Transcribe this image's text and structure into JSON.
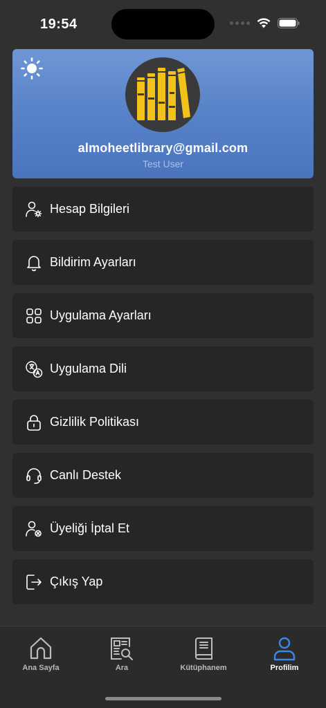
{
  "status": {
    "time": "19:54"
  },
  "profile": {
    "email": "almoheetlibrary@gmail.com",
    "name": "Test User"
  },
  "menu": [
    {
      "label": "Hesap Bilgileri",
      "icon": "user-gear-icon"
    },
    {
      "label": "Bildirim Ayarları",
      "icon": "bell-icon"
    },
    {
      "label": "Uygulama Ayarları",
      "icon": "apps-grid-icon"
    },
    {
      "label": "Uygulama Dili",
      "icon": "language-icon"
    },
    {
      "label": "Gizlilik Politikası",
      "icon": "lock-icon"
    },
    {
      "label": "Canlı Destek",
      "icon": "headset-icon"
    },
    {
      "label": "Üyeliği İptal Et",
      "icon": "user-remove-icon"
    },
    {
      "label": "Çıkış Yap",
      "icon": "logout-icon"
    }
  ],
  "nav": [
    {
      "label": "Ana Sayfa",
      "icon": "home-icon",
      "active": false
    },
    {
      "label": "Ara",
      "icon": "search-document-icon",
      "active": false
    },
    {
      "label": "Kütüphanem",
      "icon": "book-icon",
      "active": false
    },
    {
      "label": "Profilim",
      "icon": "profile-icon",
      "active": true
    }
  ],
  "colors": {
    "background": "#303030",
    "card": "#262626",
    "header_gradient_top": "#6f97d6",
    "header_gradient_bottom": "#4a74bd",
    "logo_yellow": "#f2c21b",
    "active_nav": "#3b86f0"
  }
}
